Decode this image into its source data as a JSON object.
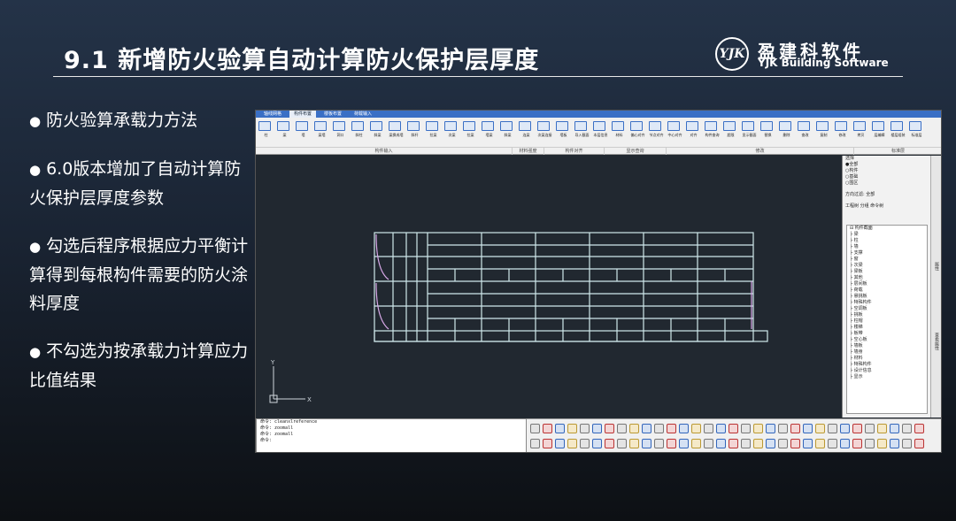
{
  "slide": {
    "title": "9.1 新增防火验算自动计算防火保护层厚度",
    "logo": {
      "mark": "YJK",
      "cn": "盈建科软件",
      "en": "YJK Building Software"
    },
    "bullets": [
      "防火验算承载力方法",
      "6.0版本增加了自动计算防火保护层厚度参数",
      "勾选后程序根据应力平衡计算得到每根构件需要的防火涂料厚度",
      "不勾选为按承载力计算应力比值结果"
    ]
  },
  "app": {
    "menu_tabs": [
      "轴线网格",
      "构件布置",
      "楼板布置",
      "荷载输入",
      "",
      "",
      "",
      "",
      "",
      "",
      "",
      ""
    ],
    "active_tab_index": 1,
    "ribbon_labels": [
      "柱",
      "梁",
      "墙",
      "梁墙",
      "洞口",
      "斜柱",
      "斜梁",
      "梁换成墙",
      "斜杆",
      "拉梁",
      "次梁",
      "拉梁",
      "墙梁",
      "斜梁",
      "连梁",
      "次梁连接",
      "墙板",
      "导入截面",
      "本层信息",
      "材料",
      "偏心对齐",
      "节点对齐",
      "中心对齐",
      "对齐",
      "构件查询",
      "超限",
      "显示截面",
      "替换",
      "删除",
      "查改",
      "复制",
      "修改",
      "拷贝",
      "层编辑",
      "楼层组装",
      "标准层"
    ],
    "ribbon_groups": [
      "构件输入",
      "材料强度",
      "构件对齐",
      "显示查询",
      "修改",
      "标准层"
    ],
    "panel": {
      "rows": [
        "选择",
        "●全部",
        "○构件",
        "○基础",
        "○围区",
        "方向过滤: 全部",
        "工程树 分组 命令树"
      ],
      "tree": [
        "构件截面",
        "梁",
        "柱",
        "墙",
        "支撑",
        "窗",
        "次梁",
        "梁板",
        "其他",
        "层间板",
        "荷载",
        "悬挑板",
        "特殊构件",
        "空调板",
        "挑板",
        "柱帽",
        "楼梯",
        "板带",
        "空心板",
        "墙板",
        "墙身",
        "材料",
        "特殊构件",
        "设计信息",
        "显示"
      ]
    },
    "vbar": [
      "属性",
      "查看属性"
    ],
    "command_lines": [
      "命令: cleanxlreference",
      "命令: zoomall",
      "命令: zoomall",
      "命令:"
    ],
    "axis": {
      "x": "X",
      "y": "Y"
    }
  }
}
